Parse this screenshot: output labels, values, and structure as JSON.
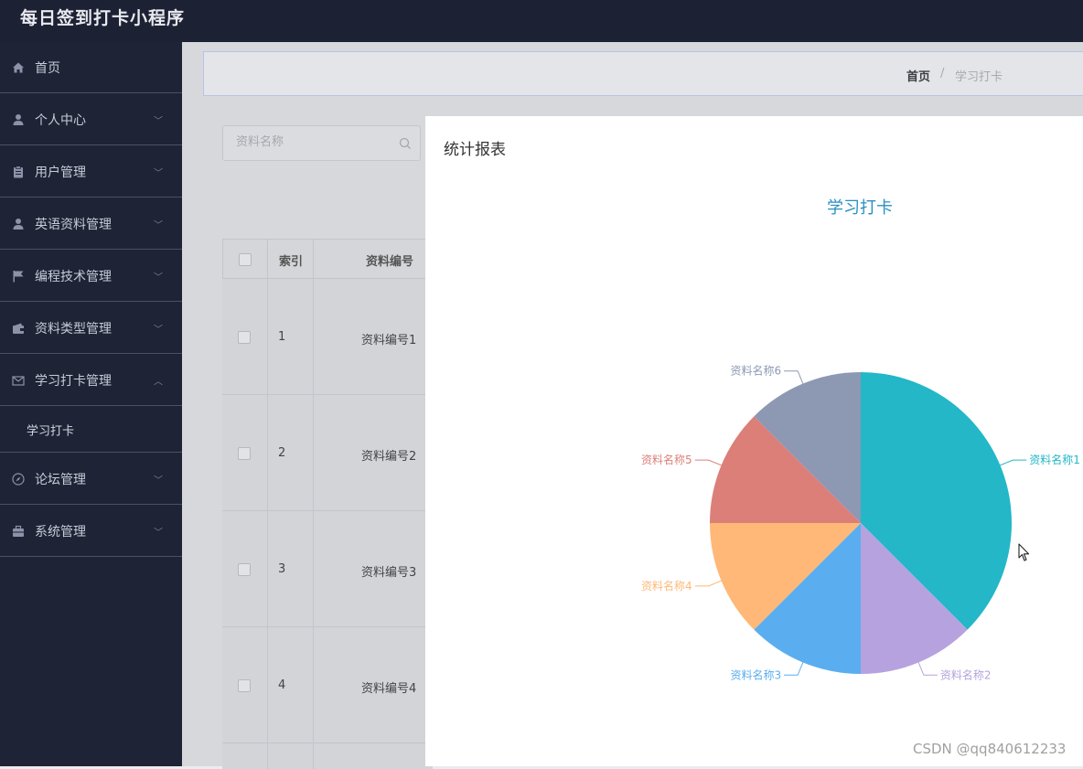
{
  "app": {
    "title": "每日签到打卡小程序"
  },
  "sidebar": {
    "items": [
      {
        "label": "首页",
        "icon": "home-icon",
        "has_arrow": false
      },
      {
        "label": "个人中心",
        "icon": "user-icon",
        "has_arrow": true,
        "arrow": "down"
      },
      {
        "label": "用户管理",
        "icon": "clipboard-icon",
        "has_arrow": true,
        "arrow": "down"
      },
      {
        "label": "英语资料管理",
        "icon": "user-icon",
        "has_arrow": true,
        "arrow": "down"
      },
      {
        "label": "编程技术管理",
        "icon": "flag-icon",
        "has_arrow": true,
        "arrow": "down"
      },
      {
        "label": "资料类型管理",
        "icon": "wallet-icon",
        "has_arrow": true,
        "arrow": "down"
      },
      {
        "label": "学习打卡管理",
        "icon": "mail-icon",
        "has_arrow": true,
        "arrow": "up",
        "expanded": true,
        "subitems": [
          {
            "label": "学习打卡"
          }
        ]
      },
      {
        "label": "论坛管理",
        "icon": "compass-icon",
        "has_arrow": true,
        "arrow": "down"
      },
      {
        "label": "系统管理",
        "icon": "briefcase-icon",
        "has_arrow": true,
        "arrow": "down"
      }
    ]
  },
  "breadcrumb": {
    "home": "首页",
    "separator": "/",
    "current": "学习打卡"
  },
  "search": {
    "placeholder": "资料名称",
    "value": ""
  },
  "table": {
    "headers": [
      "索引",
      "资料编号"
    ],
    "rows": [
      {
        "index": "1",
        "code": "资料编号1"
      },
      {
        "index": "2",
        "code": "资料编号2"
      },
      {
        "index": "3",
        "code": "资料编号3"
      },
      {
        "index": "4",
        "code": "资料编号4"
      }
    ]
  },
  "modal": {
    "title": "统计报表"
  },
  "chart_data": {
    "type": "pie",
    "title": "学习打卡",
    "categories": [
      "资料名称1",
      "资料名称2",
      "资料名称3",
      "资料名称4",
      "资料名称5",
      "资料名称6"
    ],
    "values": [
      3,
      1,
      1,
      1,
      1,
      1
    ],
    "colors": [
      "#23b7c8",
      "#b6a2de",
      "#5aaef0",
      "#ffb877",
      "#dc7f79",
      "#8d98b3"
    ]
  },
  "watermark": "CSDN @qq840612233"
}
